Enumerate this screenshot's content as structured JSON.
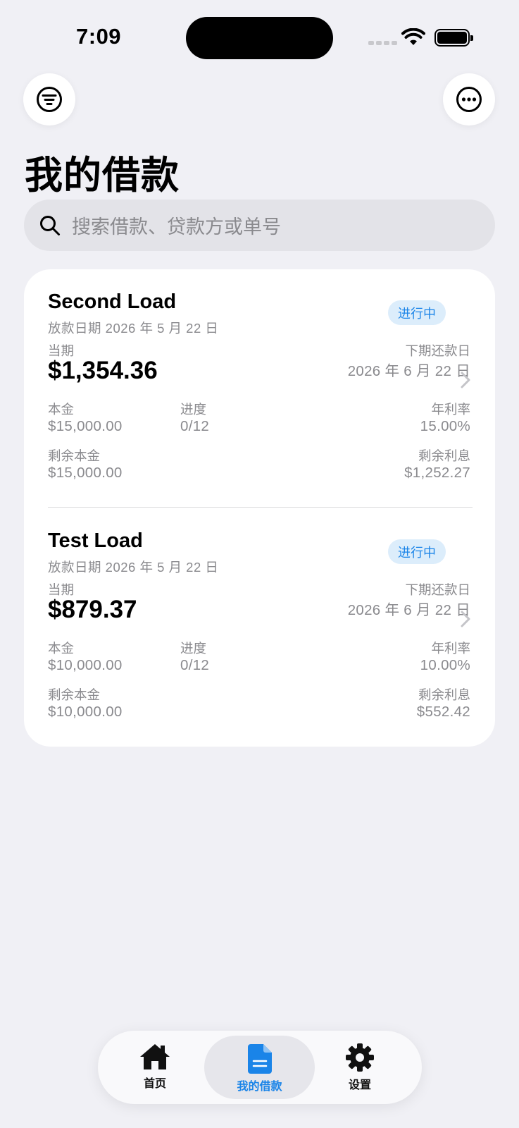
{
  "status": {
    "time": "7:09"
  },
  "header": {
    "title": "我的借款"
  },
  "search": {
    "placeholder": "搜索借款、贷款方或单号"
  },
  "labels": {
    "current": "当期",
    "next_due": "下期还款日",
    "principal": "本金",
    "progress": "进度",
    "annual_rate": "年利率",
    "remaining_principal": "剩余本金",
    "remaining_interest": "剩余利息"
  },
  "loans": [
    {
      "name": "Second Load",
      "date_label": "放款日期",
      "date_value": "2026 年 5 月 22 日",
      "status": "进行中",
      "current_amount": "$1,354.36",
      "next_due": "2026 年 6 月 22 日",
      "principal": "$15,000.00",
      "progress": "0/12",
      "rate": "15.00%",
      "remaining_principal": "$15,000.00",
      "remaining_interest": "$1,252.27"
    },
    {
      "name": "Test Load",
      "date_label": "放款日期",
      "date_value": "2026 年 5 月 22 日",
      "status": "进行中",
      "current_amount": "$879.37",
      "next_due": "2026 年 6 月 22 日",
      "principal": "$10,000.00",
      "progress": "0/12",
      "rate": "10.00%",
      "remaining_principal": "$10,000.00",
      "remaining_interest": "$552.42"
    }
  ],
  "tabbar": {
    "items": [
      {
        "label": "首页",
        "icon": "house-icon",
        "active": false
      },
      {
        "label": "我的借款",
        "icon": "document-icon",
        "active": true
      },
      {
        "label": "设置",
        "icon": "gear-icon",
        "active": false
      }
    ]
  },
  "colors": {
    "accent": "#1a84e8",
    "badge_bg": "#dcedfb",
    "background": "#f0f0f5"
  }
}
